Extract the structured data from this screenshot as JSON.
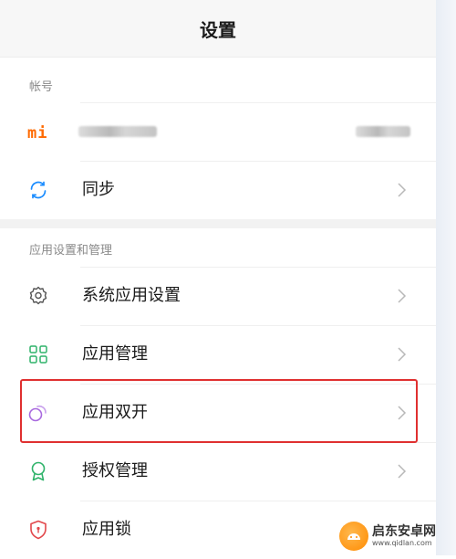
{
  "header": {
    "title": "设置"
  },
  "account_section": {
    "title": "帐号",
    "account_row": {
      "logo_text": "mi"
    },
    "sync_row": {
      "label": "同步"
    }
  },
  "apps_section": {
    "title": "应用设置和管理",
    "items": [
      {
        "label": "系统应用设置",
        "icon": "gear-icon"
      },
      {
        "label": "应用管理",
        "icon": "grid-icon"
      },
      {
        "label": "应用双开",
        "icon": "dual-circle-icon"
      },
      {
        "label": "授权管理",
        "icon": "ribbon-icon"
      },
      {
        "label": "应用锁",
        "icon": "shield-icon"
      }
    ]
  },
  "highlight_color": "#e03030",
  "watermark": {
    "name": "启东安卓网",
    "url": "www.qidlan.com"
  }
}
